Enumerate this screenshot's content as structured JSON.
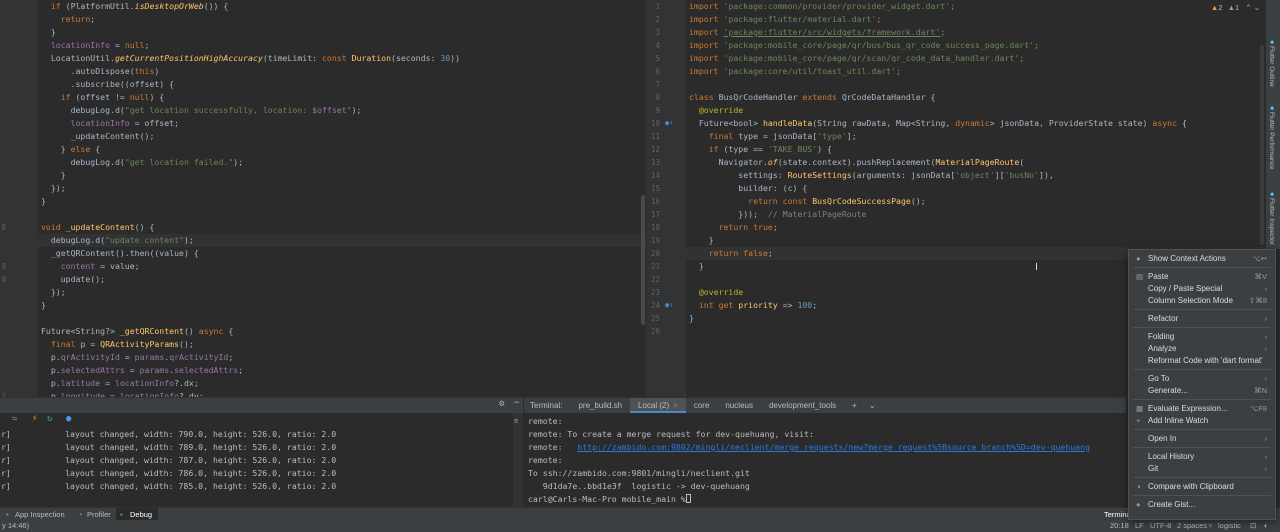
{
  "left_editor": {
    "gutter_numbers": [
      "",
      "",
      "",
      "",
      "",
      "",
      "",
      "",
      "",
      "",
      "",
      "",
      "",
      "",
      "",
      "",
      "",
      "8",
      "",
      "",
      "9",
      "0",
      "",
      "",
      "",
      "",
      "",
      "",
      "",
      "",
      "2",
      ""
    ],
    "current_line_index": 18,
    "lines": [
      [
        [
          "  ",
          "t"
        ],
        [
          "if",
          "kw"
        ],
        [
          " (PlatformUtil.",
          "t"
        ],
        [
          "isDesktopOrWeb",
          "fn it"
        ],
        [
          "()) {",
          "t"
        ]
      ],
      [
        [
          "    ",
          "t"
        ],
        [
          "return",
          "kw"
        ],
        [
          ";",
          "t"
        ]
      ],
      [
        [
          "  }",
          "t"
        ]
      ],
      [
        [
          "  ",
          "t"
        ],
        [
          "locationInfo",
          "fld"
        ],
        [
          " = ",
          "t"
        ],
        [
          "null",
          "kw"
        ],
        [
          ";",
          "t"
        ]
      ],
      [
        [
          "  LocationUtil.",
          "t"
        ],
        [
          "getCurrentPositionHighAccuracy",
          "fn it"
        ],
        [
          "(timeLimit: ",
          "t"
        ],
        [
          "const ",
          "kw"
        ],
        [
          "Duration",
          "fn"
        ],
        [
          "(seconds: ",
          "t"
        ],
        [
          "30",
          "num"
        ],
        [
          "))",
          "t"
        ]
      ],
      [
        [
          "      .autoDispose(",
          "t"
        ],
        [
          "this",
          "kw"
        ],
        [
          ")",
          "t"
        ]
      ],
      [
        [
          "      .subscribe((offset) {",
          "t"
        ]
      ],
      [
        [
          "    ",
          "t"
        ],
        [
          "if",
          "kw"
        ],
        [
          " (offset != ",
          "t"
        ],
        [
          "null",
          "kw"
        ],
        [
          ") {",
          "t"
        ]
      ],
      [
        [
          "      debugLog.d(",
          "t"
        ],
        [
          "\"get location successfully, location: ",
          "str"
        ],
        [
          "$offset",
          "fld"
        ],
        [
          "\"",
          "str"
        ],
        [
          ");",
          "t"
        ]
      ],
      [
        [
          "      ",
          "t"
        ],
        [
          "locationInfo",
          "fld"
        ],
        [
          " = offset;",
          "t"
        ]
      ],
      [
        [
          "      _updateContent();",
          "t"
        ]
      ],
      [
        [
          "    } ",
          "t"
        ],
        [
          "else",
          "kw"
        ],
        [
          " {",
          "t"
        ]
      ],
      [
        [
          "      debugLog.d(",
          "t"
        ],
        [
          "\"get location failed.\"",
          "str"
        ],
        [
          ");",
          "t"
        ]
      ],
      [
        [
          "    }",
          "t"
        ]
      ],
      [
        [
          "  });",
          "t"
        ]
      ],
      [
        [
          "}",
          "t"
        ]
      ],
      [
        [
          "",
          "t"
        ]
      ],
      [
        [
          "void ",
          "kw"
        ],
        [
          "_updateContent",
          "fn"
        ],
        [
          "() {",
          "t"
        ]
      ],
      [
        [
          "  debugLog.d(",
          "t"
        ],
        [
          "\"update content\"",
          "str"
        ],
        [
          ");",
          "t"
        ]
      ],
      [
        [
          "  _getQRContent().then((value) {",
          "t"
        ]
      ],
      [
        [
          "    ",
          "t"
        ],
        [
          "content",
          "fld"
        ],
        [
          " = value;",
          "t"
        ]
      ],
      [
        [
          "    update();",
          "t"
        ]
      ],
      [
        [
          "  });",
          "t"
        ]
      ],
      [
        [
          "}",
          "t"
        ]
      ],
      [
        [
          "",
          "t"
        ]
      ],
      [
        [
          "Future<String?> ",
          "t"
        ],
        [
          "_getQRContent",
          "fn"
        ],
        [
          "() ",
          "t"
        ],
        [
          "async",
          "kw"
        ],
        [
          " {",
          "t"
        ]
      ],
      [
        [
          "  ",
          "t"
        ],
        [
          "final",
          "kw"
        ],
        [
          " p = ",
          "t"
        ],
        [
          "QRActivityParams",
          "fn"
        ],
        [
          "();",
          "t"
        ]
      ],
      [
        [
          "  p.",
          "t"
        ],
        [
          "qrActivityId",
          "fld"
        ],
        [
          " = ",
          "t"
        ],
        [
          "params",
          "fld"
        ],
        [
          ".",
          "t"
        ],
        [
          "qrActivityId",
          "fld"
        ],
        [
          ";",
          "t"
        ]
      ],
      [
        [
          "  p.",
          "t"
        ],
        [
          "selectedAttrs",
          "fld"
        ],
        [
          " = ",
          "t"
        ],
        [
          "params",
          "fld"
        ],
        [
          ".",
          "t"
        ],
        [
          "selectedAttrs",
          "fld"
        ],
        [
          ";",
          "t"
        ]
      ],
      [
        [
          "  p.",
          "t"
        ],
        [
          "latitude",
          "fld"
        ],
        [
          " = ",
          "t"
        ],
        [
          "locationInfo",
          "fld"
        ],
        [
          "?.dx;",
          "t"
        ]
      ],
      [
        [
          "  p.",
          "t"
        ],
        [
          "longitude",
          "fld"
        ],
        [
          " = ",
          "t"
        ],
        [
          "locationInfo",
          "fld"
        ],
        [
          "?.dy;",
          "t"
        ]
      ]
    ]
  },
  "right_editor": {
    "inspection": {
      "warnings": "2",
      "weak": "1"
    },
    "current_line_index": 19,
    "gutter_numbers": [
      "1",
      "2",
      "3",
      "4",
      "5",
      "6",
      "7",
      "8",
      "9",
      "10",
      "11",
      "12",
      "13",
      "14",
      "15",
      "16",
      "17",
      "18",
      "19",
      "20",
      "21",
      "22",
      "23",
      "24",
      "25",
      "26"
    ],
    "lines": [
      [
        [
          "import ",
          "kw"
        ],
        [
          "'package:common/provider/provider_widget.dart'",
          "str"
        ],
        [
          ";",
          "kw"
        ]
      ],
      [
        [
          "import ",
          "kw"
        ],
        [
          "'package:flutter/material.dart'",
          "str"
        ],
        [
          ";",
          "kw"
        ]
      ],
      [
        [
          "import ",
          "kw"
        ],
        [
          "'package:flutter/src/widgets/framework.dart'",
          "str ul"
        ],
        [
          ";",
          "kw"
        ]
      ],
      [
        [
          "import ",
          "kw"
        ],
        [
          "'package:mobile_core/page/qr/bus/bus_qr_code_success_page.dart'",
          "str"
        ],
        [
          ";",
          "kw"
        ]
      ],
      [
        [
          "import ",
          "kw"
        ],
        [
          "'package:mobile_core/page/qr/scan/qr_code_data_handler.dart'",
          "str"
        ],
        [
          ";",
          "kw"
        ]
      ],
      [
        [
          "import ",
          "kw"
        ],
        [
          "'package:core/util/toast_util.dart'",
          "str"
        ],
        [
          ";",
          "kw"
        ]
      ],
      [
        [
          "",
          "t"
        ]
      ],
      [
        [
          "class ",
          "kw"
        ],
        [
          "BusQrCodeHandler ",
          "t"
        ],
        [
          "extends ",
          "kw"
        ],
        [
          "QrCodeDataHandler {",
          "t"
        ]
      ],
      [
        [
          "  ",
          "t"
        ],
        [
          "@override",
          "ann"
        ]
      ],
      [
        [
          "  Future<bool> ",
          "t"
        ],
        [
          "handleData",
          "fn"
        ],
        [
          "(String rawData, Map<String, ",
          "t"
        ],
        [
          "dynamic",
          "kw"
        ],
        [
          "> jsonData, ProviderState state) ",
          "t"
        ],
        [
          "async",
          "kw"
        ],
        [
          " {",
          "t"
        ]
      ],
      [
        [
          "    ",
          "t"
        ],
        [
          "final",
          "kw"
        ],
        [
          " type = jsonData[",
          "t"
        ],
        [
          "'type'",
          "str"
        ],
        [
          "];",
          "t"
        ]
      ],
      [
        [
          "    ",
          "t"
        ],
        [
          "if",
          "kw"
        ],
        [
          " (type == ",
          "t"
        ],
        [
          "'TAKE_BUS'",
          "str"
        ],
        [
          ") {",
          "t"
        ]
      ],
      [
        [
          "      Navigator.",
          "t"
        ],
        [
          "of",
          "fn it"
        ],
        [
          "(state.context).pushReplacement(",
          "t"
        ],
        [
          "MaterialPageRoute",
          "fn"
        ],
        [
          "(",
          "t"
        ]
      ],
      [
        [
          "          settings: ",
          "t"
        ],
        [
          "RouteSettings",
          "fn"
        ],
        [
          "(arguments: jsonData[",
          "t"
        ],
        [
          "'object'",
          "str"
        ],
        [
          "][",
          "t"
        ],
        [
          "'busNo'",
          "str"
        ],
        [
          "]),",
          "t"
        ]
      ],
      [
        [
          "          builder: (c) {",
          "t"
        ]
      ],
      [
        [
          "            ",
          "t"
        ],
        [
          "return const ",
          "kw"
        ],
        [
          "BusQrCodeSuccessPage",
          "fn"
        ],
        [
          "();",
          "t"
        ]
      ],
      [
        [
          "          }));  ",
          "t"
        ],
        [
          "// MaterialPageRoute",
          "cmt"
        ]
      ],
      [
        [
          "      ",
          "t"
        ],
        [
          "return true",
          "kw"
        ],
        [
          ";",
          "t"
        ]
      ],
      [
        [
          "    }",
          "t"
        ]
      ],
      [
        [
          "    ",
          "t"
        ],
        [
          "return false",
          "kw"
        ],
        [
          ";",
          "t"
        ]
      ],
      [
        [
          "  }",
          "t"
        ]
      ],
      [
        [
          "",
          "t"
        ]
      ],
      [
        [
          "  ",
          "t"
        ],
        [
          "@override",
          "ann"
        ]
      ],
      [
        [
          "  ",
          "t"
        ],
        [
          "int get ",
          "kw"
        ],
        [
          "priority",
          "fn"
        ],
        [
          " => ",
          "t"
        ],
        [
          "100",
          "num"
        ],
        [
          ";",
          "t"
        ]
      ],
      [
        [
          "}",
          "t"
        ]
      ],
      [
        [
          "",
          "t"
        ]
      ]
    ]
  },
  "right_sidebar": {
    "tabs": [
      "Flutter Outline",
      "Flutter Performance",
      "Flutter Inspector"
    ]
  },
  "run_panel": {
    "lines": [
      "r]           layout changed, width: 790.0, height: 526.0, ratio: 2.0",
      "r]           layout changed, width: 789.0, height: 526.0, ratio: 2.0",
      "r]           layout changed, width: 787.0, height: 526.0, ratio: 2.0",
      "r]           layout changed, width: 786.0, height: 526.0, ratio: 2.0",
      "r]           layout changed, width: 785.0, height: 526.0, ratio: 2.0"
    ]
  },
  "terminal": {
    "label": "Terminal:",
    "tabs": [
      "pre_build.sh",
      "Local (2)",
      "core",
      "nucleus",
      "development_tools"
    ],
    "active_tab_index": 1,
    "add_label": "+",
    "lines": [
      {
        "text": "remote:"
      },
      {
        "text": "remote: To create a merge request for dev-quehuang, visit:"
      },
      {
        "text": "remote:   ",
        "link": "http://zambido.com:9802/mingli/neclient/merge_requests/new?merge_request%5Bsource_branch%5D=dev-quehuang"
      },
      {
        "text": "remote:"
      },
      {
        "text": "To ssh://zambido.com:9801/mingli/neclient.git"
      },
      {
        "text": "   9d1da7e..bbd1e3f  logistic -> dev-quehuang"
      },
      {
        "text": "carl@Carls-Mac-Pro mobile_main % "
      }
    ]
  },
  "toolstrip": {
    "items": [
      "App Inspection",
      "Profiler",
      "Debug"
    ],
    "active": "Debug",
    "terminal_label": "Terminal"
  },
  "status_bar": {
    "left": "y 14:46)",
    "position": "20:18",
    "line_sep": "LF",
    "encoding": "UTF-8",
    "indent": "2 spaces",
    "branch": "logistic"
  },
  "context_menu": {
    "items": [
      {
        "label": "Show Context Actions",
        "shortcut": "⌥↩",
        "icon": "bulb-icon"
      },
      {
        "sep": true
      },
      {
        "label": "Paste",
        "shortcut": "⌘V",
        "icon": "paste-icon"
      },
      {
        "label": "Copy / Paste Special",
        "submenu": true
      },
      {
        "label": "Column Selection Mode",
        "shortcut": "⇧⌘8"
      },
      {
        "sep": true
      },
      {
        "label": "Refactor",
        "submenu": true
      },
      {
        "sep": true
      },
      {
        "label": "Folding",
        "submenu": true
      },
      {
        "label": "Analyze",
        "submenu": true
      },
      {
        "label": "Reformat Code with 'dart format'"
      },
      {
        "sep": true
      },
      {
        "label": "Go To",
        "submenu": true
      },
      {
        "label": "Generate...",
        "shortcut": "⌘N"
      },
      {
        "sep": true
      },
      {
        "label": "Evaluate Expression...",
        "shortcut": "⌥F8",
        "icon": "calculator-icon"
      },
      {
        "label": "Add Inline Watch",
        "icon": "plus-icon"
      },
      {
        "sep": true
      },
      {
        "label": "Open In",
        "submenu": true
      },
      {
        "sep": true
      },
      {
        "label": "Local History",
        "submenu": true
      },
      {
        "label": "Git",
        "submenu": true
      },
      {
        "sep": true
      },
      {
        "label": "Compare with Clipboard",
        "icon": "compare-icon"
      },
      {
        "sep": true
      },
      {
        "label": "Create Gist...",
        "icon": "github-icon"
      }
    ]
  }
}
